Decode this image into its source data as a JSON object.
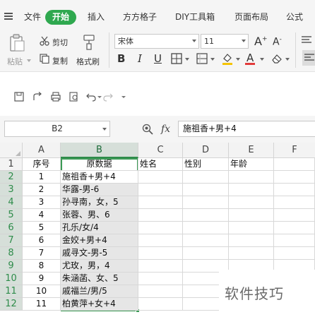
{
  "menubar": {
    "file": "文件",
    "tabs": [
      "开始",
      "插入",
      "方方格子",
      "DIY工具箱",
      "页面布局",
      "公式"
    ]
  },
  "ribbon": {
    "paste": "粘贴",
    "cut": "剪切",
    "copy": "复制",
    "format_painter": "格式刷",
    "font_name": "宋体",
    "font_size": "11",
    "grow_font": "A⁺",
    "shrink_font": "A⁻",
    "bold": "B",
    "italic": "I",
    "underline": "U",
    "font_color_letter": "A",
    "accent_color": "#2fa84f",
    "font_color": "#e23b3b",
    "fill_color": "#f5c400"
  },
  "formula_bar": {
    "name_box": "B2",
    "fx": "fx",
    "content": "施祖香+男+4"
  },
  "sheet": {
    "columns": [
      "A",
      "B",
      "C",
      "D",
      "E",
      "F"
    ],
    "rows": [
      "1",
      "2",
      "3",
      "4",
      "5",
      "6",
      "7",
      "8",
      "9",
      "10",
      "11",
      "12"
    ],
    "headers": [
      "序号",
      "原数据",
      "姓名",
      "性别",
      "年龄"
    ],
    "data": [
      {
        "a": "1",
        "b": "施祖香+男+4"
      },
      {
        "a": "2",
        "b": "华露-男-6"
      },
      {
        "a": "3",
        "b": "孙寻南，女，5"
      },
      {
        "a": "4",
        "b": "张蓉、男、6"
      },
      {
        "a": "5",
        "b": "孔乐/女/4"
      },
      {
        "a": "6",
        "b": "金姣+男+4"
      },
      {
        "a": "7",
        "b": "戚寻文-男-5"
      },
      {
        "a": "8",
        "b": "尤玫，男，4"
      },
      {
        "a": "9",
        "b": "朱涵菡、女、5"
      },
      {
        "a": "10",
        "b": "戚福兰/男/5"
      },
      {
        "a": "11",
        "b": "柏黄萍+女+4"
      }
    ]
  },
  "watermark": "软件技巧"
}
